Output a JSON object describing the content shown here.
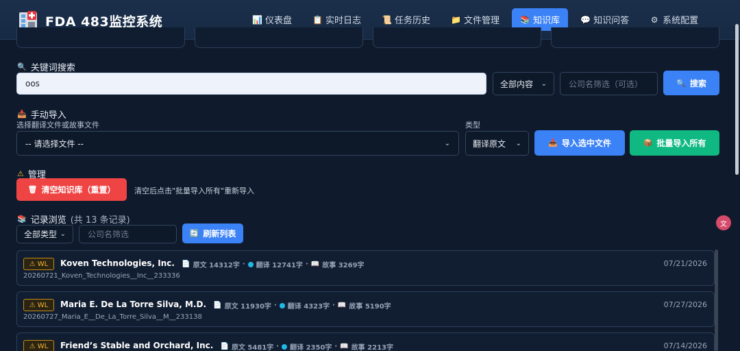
{
  "app": {
    "title": "FDA 483监控系统"
  },
  "nav": [
    {
      "icon": "📊",
      "icon_name": "bar-chart-icon",
      "label": "仪表盘"
    },
    {
      "icon": "📋",
      "icon_name": "clipboard-icon",
      "label": "实时日志"
    },
    {
      "icon": "📜",
      "icon_name": "scroll-icon",
      "label": "任务历史"
    },
    {
      "icon": "📁",
      "icon_name": "folder-icon",
      "label": "文件管理"
    },
    {
      "icon": "📚",
      "icon_name": "books-icon",
      "label": "知识库",
      "active": true
    },
    {
      "icon": "💬",
      "icon_name": "chat-icon",
      "label": "知识问答"
    },
    {
      "icon": "⚙",
      "icon_name": "gear-icon",
      "label": "系统配置"
    }
  ],
  "search": {
    "title": "关键词搜索",
    "value": "oos",
    "scope_selected": "全部内容",
    "company_placeholder": "公司名筛选（可选）",
    "button": "搜索"
  },
  "import": {
    "title": "手动导入",
    "file_label": "选择翻译文件或故事文件",
    "file_selected": "-- 请选择文件 --",
    "type_label": "类型",
    "type_selected": "翻译原文",
    "import_selected_button": "导入选中文件",
    "import_all_button": "批量导入所有"
  },
  "manage": {
    "title": "管理",
    "clear_button": "清空知识库（重置）",
    "hint": "清空后点击\"批量导入所有\"重新导入"
  },
  "browse": {
    "title": "记录浏览",
    "count_text": "(共 13 条记录)",
    "type_selected": "全部类型",
    "company_placeholder": "公司名筛选",
    "refresh_button": "刷新列表"
  },
  "records": [
    {
      "badge": "WL",
      "company": "Koven Technologies, Inc.",
      "orig": "原文 14312字",
      "trans": "翻译 12741字",
      "story": "故事 3269字",
      "file": "20260721_Koven_Technologies__Inc__233336",
      "date": "07/21/2026"
    },
    {
      "badge": "WL",
      "company": "Maria E. De La Torre Silva, M.D.",
      "orig": "原文 11930字",
      "trans": "翻译 4323字",
      "story": "故事 5190字",
      "file": "20260727_Maria_E__De_La_Torre_Silva__M__233138",
      "date": "07/27/2026"
    },
    {
      "badge": "WL",
      "company": "Friend’s Stable and Orchard, Inc.",
      "orig": "原文 5481字",
      "trans": "翻译 2350字",
      "story": "故事 2213字",
      "file": "",
      "date": "07/14/2026"
    }
  ],
  "colors": {
    "accent_blue": "#3b82f6",
    "accent_green": "#10b981",
    "danger_red": "#ef4444",
    "badge_amber": "#f5b82e"
  }
}
